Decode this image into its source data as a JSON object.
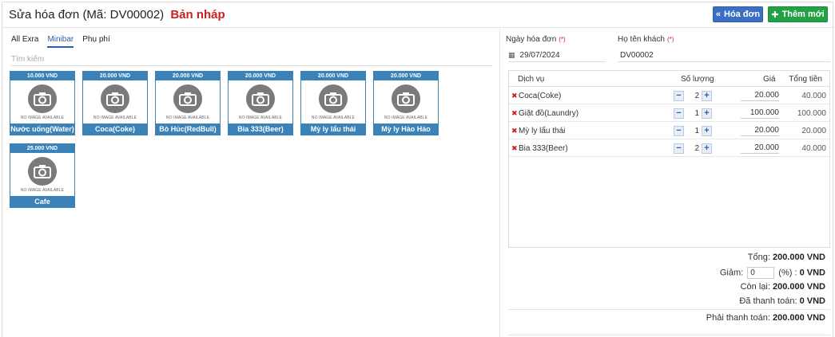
{
  "header": {
    "title": "Sửa hóa đơn (Mã: DV00002)",
    "status": "Bản nháp",
    "invoice_button": "Hóa đơn",
    "new_button": "Thêm mới"
  },
  "tabs": [
    {
      "label": "All Exra",
      "active": false
    },
    {
      "label": "Minibar",
      "active": true
    },
    {
      "label": "Phụ phí",
      "active": false
    }
  ],
  "search": {
    "placeholder": "Tìm kiếm",
    "value": ""
  },
  "no_image_text": "NO IMAGE AVAILABLE",
  "products": [
    {
      "price": "10.000 VND",
      "name": "Nước uống(Water)"
    },
    {
      "price": "20.000 VND",
      "name": "Coca(Coke)"
    },
    {
      "price": "20.000 VND",
      "name": "Bò Húc(RedBull)"
    },
    {
      "price": "20.000 VND",
      "name": "Bia 333(Beer)"
    },
    {
      "price": "20.000 VND",
      "name": "Mỳ ly lẩu thái"
    },
    {
      "price": "20.000 VND",
      "name": "Mỳ ly Hảo Hảo"
    },
    {
      "price": "25.000 VND",
      "name": "Cafe"
    }
  ],
  "form": {
    "date_label": "Ngày hóa đơn",
    "date_value": "29/07/2024",
    "customer_label": "Họ tên khách",
    "customer_value": "DV00002",
    "required_mark": "(*)"
  },
  "table": {
    "headers": {
      "service": "Dịch vụ",
      "qty": "Số lượng",
      "price": "Giá",
      "total": "Tổng tiền"
    },
    "rows": [
      {
        "service": "Coca(Coke)",
        "qty": "2",
        "price": "20.000",
        "total": "40.000"
      },
      {
        "service": "Giặt đồ(Laundry)",
        "qty": "1",
        "price": "100.000",
        "total": "100.000"
      },
      {
        "service": "Mỳ ly lẩu thái",
        "qty": "1",
        "price": "20.000",
        "total": "20.000"
      },
      {
        "service": "Bia 333(Beer)",
        "qty": "2",
        "price": "20.000",
        "total": "40.000"
      }
    ]
  },
  "summary": {
    "total_label": "Tổng:",
    "total_value": "200.000 VND",
    "discount_label": "Giảm:",
    "discount_input": "0",
    "discount_unit": "(%) :",
    "discount_value": "0 VND",
    "remaining_label": "Còn lại:",
    "remaining_value": "200.000 VND",
    "paid_label": "Đã thanh toán:",
    "paid_value": "0 VND",
    "due_label": "Phải thanh toán:",
    "due_value": "200.000 VND"
  },
  "colors": {
    "brand_blue": "#3a82b8",
    "invoice_button": "#3b6fc4",
    "new_button": "#23a145",
    "draft_red": "#cc2020"
  }
}
